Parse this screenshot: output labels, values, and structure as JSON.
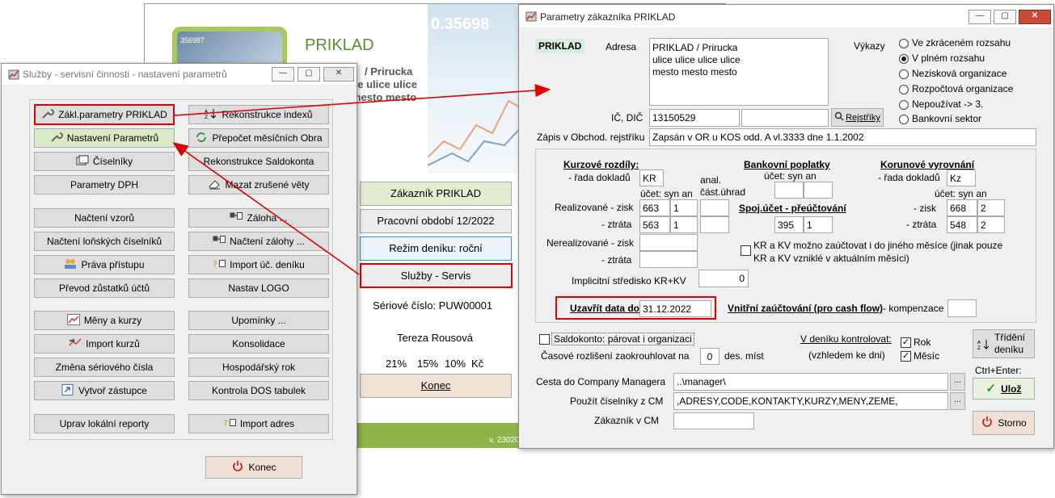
{
  "bg": {
    "company": "PRIKLAD",
    "address1": "/ Prirucka",
    "address2": "ce ulice ulice",
    "address3": "mesto mesto",
    "ticker": "0.35698",
    "logo_text": "356987",
    "buttons": {
      "zakaznik": "Zákazník  PRIKLAD",
      "obdobi": "Pracovní období 12/2022",
      "rezim": "Režim deníku: roční",
      "sluzby": "Služby - Servis"
    },
    "serial": "Sériové číslo: PUW00001",
    "user": "Tereza Rousová",
    "vat": [
      "21%",
      "15%",
      "10%",
      "Kč"
    ],
    "konec": "Konec",
    "version": "v. 23020"
  },
  "services": {
    "title": "Služby - servisní činnosti - nastavení parametrů",
    "left": [
      "Zákl.parametry PRIKLAD",
      "Nastavení Parametrů",
      "Číselníky",
      "Parametry DPH",
      "Načtení vzorů",
      "Načtení loňských číselníků",
      "Práva přístupu",
      "Převod zůstatků účtů",
      "Měny a kurzy",
      "Import kurzů",
      "Změna sériového čísla",
      "Vytvoř zástupce",
      "Uprav lokální reporty"
    ],
    "right": [
      "Rekonstrukce indexů",
      "Přepočet měsíčních Obra",
      "Rekonstrukce Saldokonta",
      "Mazat zrušené věty",
      "Záloha ...",
      "Načtení zálohy ...",
      "Import úč. deníku",
      "Nastav LOGO",
      "Upomínky ...",
      "Konsolidace",
      "Hospodářský rok",
      "Kontrola DOS tabulek",
      "Import adres"
    ],
    "konec": "Konec"
  },
  "params": {
    "title": "Parametry zákazníka PRIKLAD",
    "code": "PRIKLAD",
    "adresa_label": "Adresa",
    "adresa_lines": [
      "PRIKLAD / Prirucka",
      "ulice ulice ulice ulice",
      "mesto mesto mesto"
    ],
    "vykazy_label": "Výkazy",
    "vykazy_options": [
      {
        "label": "Ve zkráceném rozsahu",
        "selected": false
      },
      {
        "label": "V plném rozsahu",
        "selected": true
      },
      {
        "label": "Nezisková organizace",
        "selected": false
      },
      {
        "label": "Rozpočtová organizace",
        "selected": false
      },
      {
        "label": "Nepoužívat -> 3.",
        "selected": false
      },
      {
        "label": "Bankovní sektor",
        "selected": false
      }
    ],
    "ic_label": "IČ, DIČ",
    "ic": "13150529",
    "dic": "",
    "rejstriky": "Rejstříky",
    "zapis_label": "Zápis v Obchod. rejstříku",
    "zapis": "Zapsán v OR u KOS odd. A vl.3333 dne 1.1.2002",
    "kurzove": {
      "title": "Kurzové rozdíly:",
      "rada_label": "- řada dokladů",
      "rada": "KR",
      "ucet_label": "účet: syn an",
      "anal_label": "anal. část.úhrad",
      "real_zisk_label": "Realizované - zisk",
      "real_zisk_syn": "663",
      "real_zisk_an": "1",
      "ztrata_label": "- ztráta",
      "real_ztrata_syn": "563",
      "real_ztrata_an": "1",
      "nereal_zisk_label": "Nerealizované - zisk",
      "nereal_ztrata_label": "- ztráta"
    },
    "bankovni": {
      "title": "Bankovní poplatky",
      "ucet_label": "účet: syn an"
    },
    "spoj": {
      "title": "Spoj.účet - přeúčtování",
      "syn": "395",
      "an": "1"
    },
    "korunove": {
      "title": "Korunové vyrovnání",
      "rada_label": "- řada dokladů",
      "rada": "Kz",
      "ucet_label": "účet: syn an",
      "zisk_label": "- zisk",
      "zisk_syn": "668",
      "zisk_an": "2",
      "ztrata_label": "- ztráta",
      "ztrata_syn": "548",
      "ztrata_an": "2"
    },
    "kr_kv_text1": "KR a KV možno zaúčtovat i do jiného měsíce (jinak pouze",
    "kr_kv_text2": "KR a KV vzniklé v aktuálním měsíci)",
    "implicitni_label": "Implicitní středisko KR+KV",
    "implicitni": "0",
    "uzavrit_label": "Uzavřít data do",
    "uzavrit": "31.12.2022",
    "vnitrni_label": "Vnitřní zaúčtování (pro cash flow)",
    "kompenzace_label": "- kompenzace",
    "saldokonto": "Saldokonto: párovat i organizaci",
    "casove_label": "Časové rozlišení zaokrouhlovat na",
    "casove": "0",
    "casove_unit": "des. míst",
    "v_deniku_label": "V deníku kontrolovat:",
    "vzhledem": "(vzhledem ke dni)",
    "rok": "Rok",
    "mesic": "Měsíc",
    "trideni": "Třídění deníku",
    "ctrl_enter": "Ctrl+Enter:",
    "uloz": "Ulož",
    "storno": "Storno",
    "cesta_label": "Cesta do Company Managera",
    "cesta": "..\\manager\\",
    "pouzit_label": "Použít číselníky z CM",
    "pouzit": ",ADRESY,CODE,KONTAKTY,KURZY,MENY,ZEME,",
    "zakaznik_label": "Zákazník v CM",
    "zakaznik": "",
    "ellipsis": "..."
  }
}
